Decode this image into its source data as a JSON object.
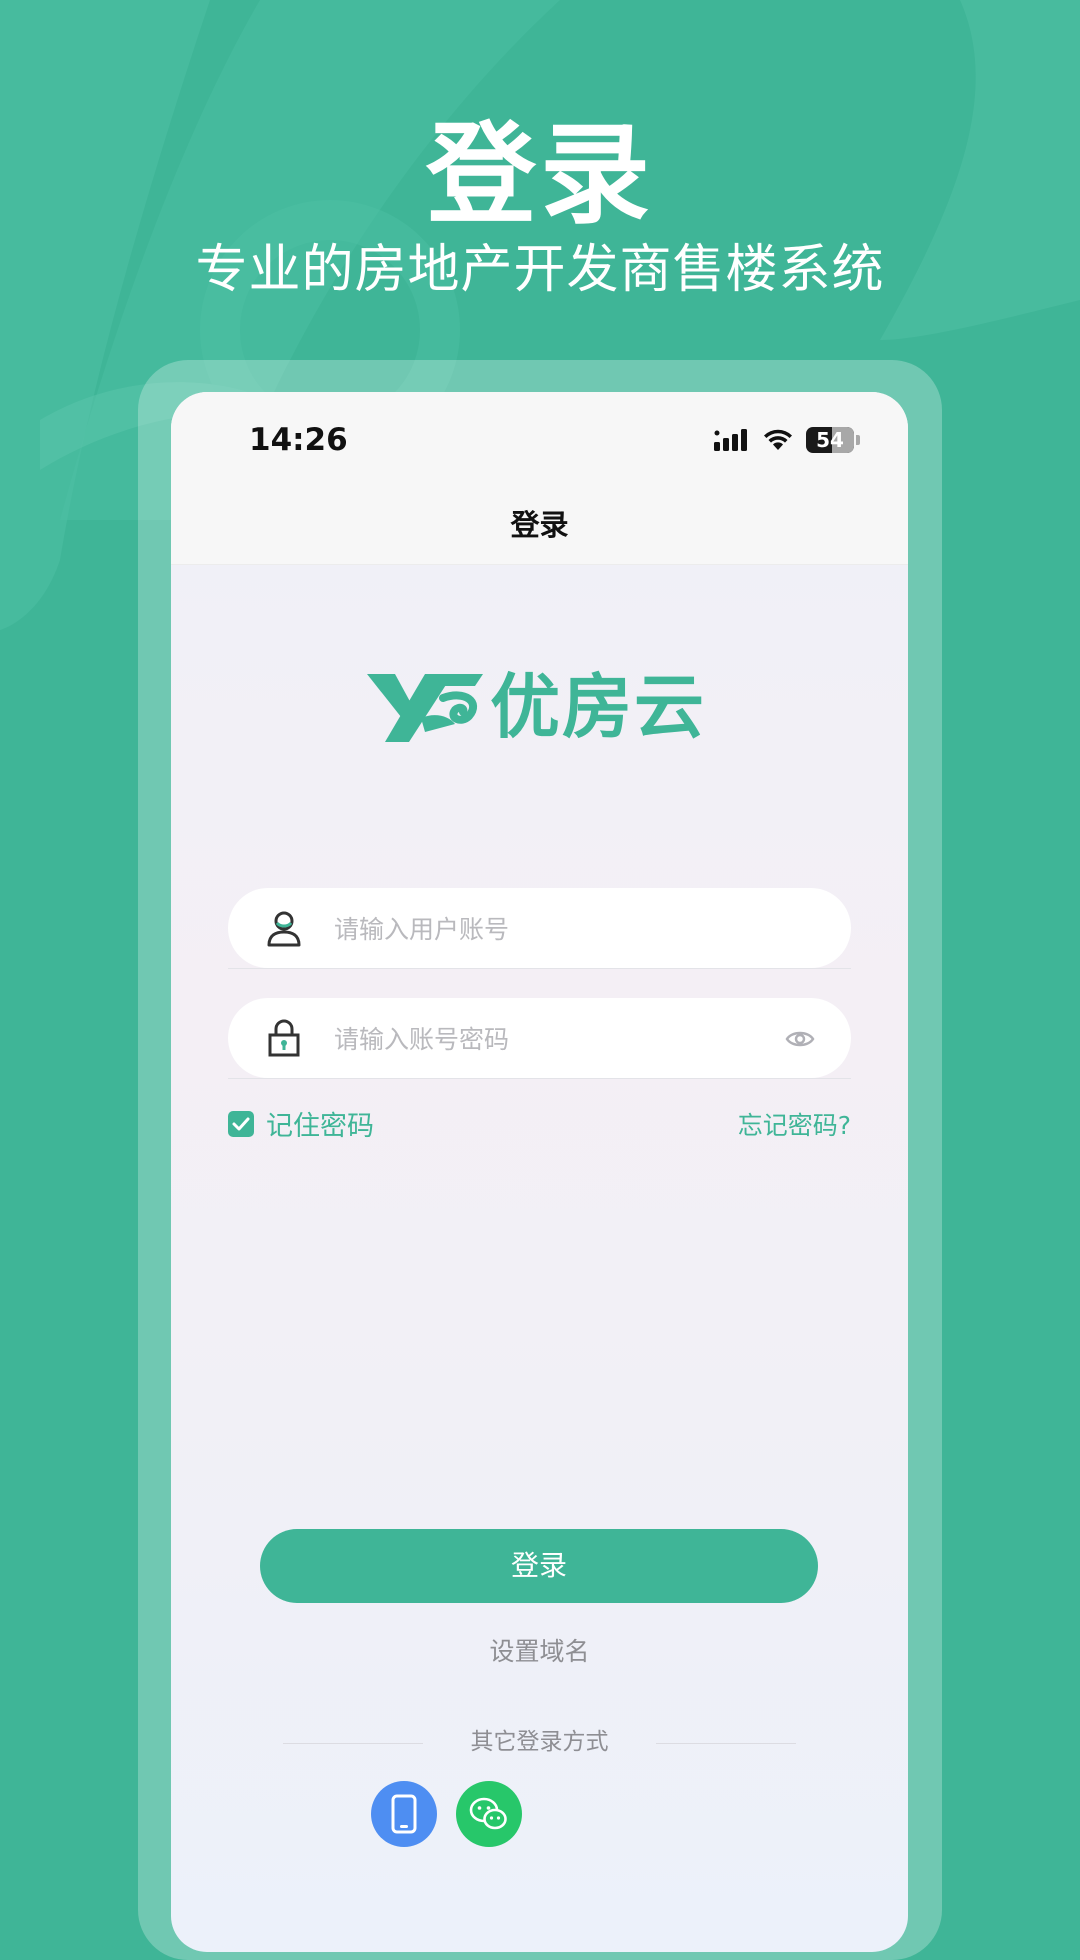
{
  "promo": {
    "title": "登录",
    "subtitle": "专业的房地产开发商售楼系统"
  },
  "status_bar": {
    "time": "14:26",
    "battery": "54",
    "icons": [
      "signal-icon",
      "wifi-icon",
      "battery-icon"
    ]
  },
  "nav": {
    "title": "登录"
  },
  "logo": {
    "text": "优房云"
  },
  "form": {
    "username_placeholder": "请输入用户账号",
    "username_value": "",
    "password_placeholder": "请输入账号密码",
    "password_value": "",
    "remember_label": "记住密码",
    "remember_checked": true,
    "forgot_label": "忘记密码?"
  },
  "actions": {
    "login_label": "登录",
    "domain_label": "设置域名",
    "other_label": "其它登录方式",
    "alt_methods": [
      {
        "name": "phone-login",
        "icon": "mobile-phone-icon",
        "color": "#4e8ef2"
      },
      {
        "name": "wechat-login",
        "icon": "wechat-icon",
        "color": "#27c76a"
      }
    ]
  },
  "colors": {
    "brand": "#3fb597",
    "background": "#3fb597"
  }
}
